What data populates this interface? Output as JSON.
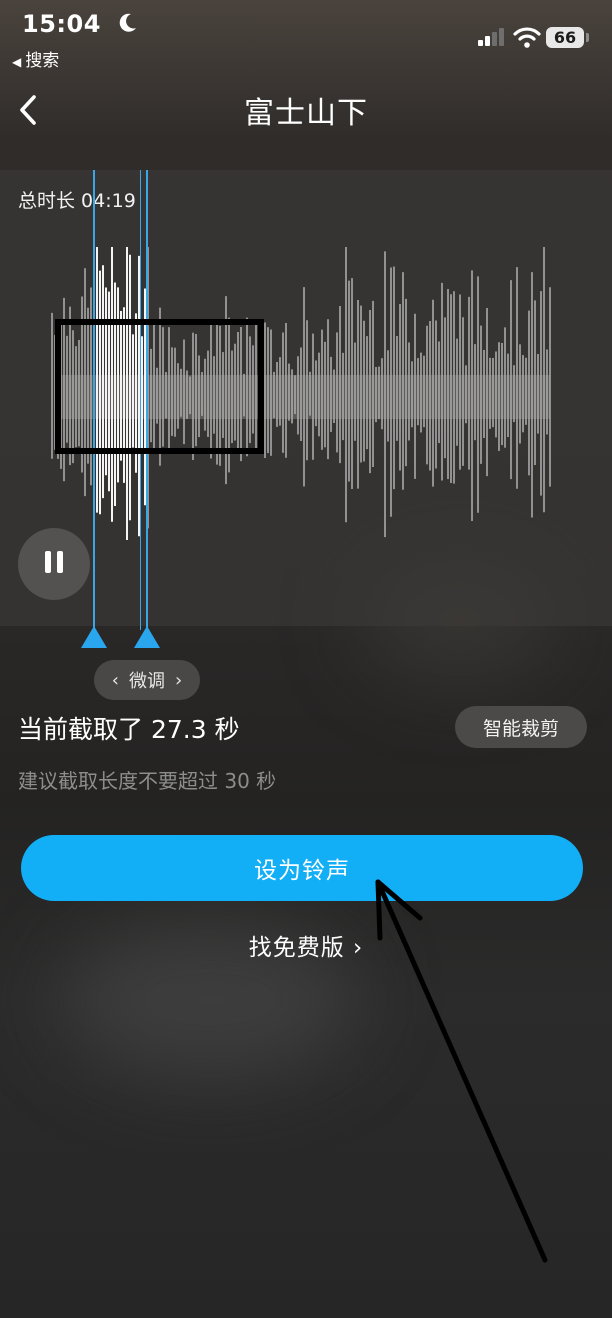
{
  "status_bar": {
    "time": "15:04",
    "back_app_label": "搜索",
    "battery_level": "66",
    "icons": [
      "moon-icon",
      "cellular-signal-icon",
      "wifi-icon",
      "battery-icon"
    ]
  },
  "header": {
    "title": "富士山下",
    "back_icon": "chevron-left-icon"
  },
  "editor": {
    "total_duration_label": "总时长 04:19",
    "play_state_icon": "pause-icon",
    "fine_tune_label": "微调",
    "clip_length_text": "当前截取了 27.3 秒",
    "smart_trim_label": "智能裁剪",
    "hint_text": "建议截取长度不要超过 30 秒"
  },
  "actions": {
    "set_ringtone_label": "设为铃声",
    "free_version_label": "找免费版 ›"
  },
  "colors": {
    "accent_blue": "#12aef6",
    "handle_blue": "#2aa6ee",
    "waveform_gray": "#a9a9a9"
  }
}
